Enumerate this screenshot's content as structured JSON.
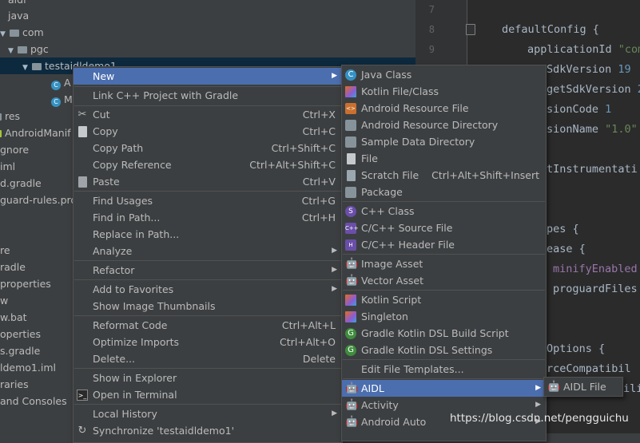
{
  "tree": {
    "items": [
      "aidl",
      "java",
      "com",
      "pgc",
      "testaidldemo1",
      "A",
      "M",
      "res",
      "AndroidManif",
      "gnore",
      "iml",
      "d.gradle",
      "guard-rules.pro",
      "re",
      "radle",
      "properties",
      "w",
      "w.bat",
      "operties",
      "s.gradle",
      "ldemo1.iml",
      "raries",
      "and Consoles"
    ],
    "class_icon_letter": "C"
  },
  "editor": {
    "line_numbers": [
      "7",
      "8",
      "9"
    ],
    "lines": [
      {
        "a": "defaultConfig {",
        "b": "",
        "c": ""
      },
      {
        "a": "applicationId ",
        "b": "\"com",
        "c": ""
      },
      {
        "a": "SdkVersion ",
        "b": "19",
        "c": ""
      },
      {
        "a": "getSdkVersion ",
        "b": "2",
        "c": ""
      },
      {
        "a": "sionCode ",
        "b": "1",
        "c": ""
      },
      {
        "a": "sionName ",
        "b": "\"1.0\"",
        "c": ""
      },
      {
        "a": "tInstrumentati",
        "b": "",
        "c": ""
      },
      {
        "a": "pes {",
        "b": "",
        "c": ""
      },
      {
        "a": "ease {",
        "b": "",
        "c": ""
      },
      {
        "a": "",
        "b": "minifyEnabled",
        "c": ""
      },
      {
        "a": "proguardFiles",
        "b": "",
        "c": ""
      },
      {
        "a": "Options {",
        "b": "",
        "c": ""
      },
      {
        "a": "rceCompatibil",
        "b": "",
        "c": ""
      },
      {
        "a": "ili",
        "b": "",
        "c": ""
      }
    ]
  },
  "context_menu": {
    "items": [
      {
        "label": "New",
        "shortcut": "",
        "submenu": true
      },
      {
        "label": "Link C++ Project with Gradle",
        "shortcut": ""
      },
      {
        "label": "Cut",
        "shortcut": "Ctrl+X"
      },
      {
        "label": "Copy",
        "shortcut": "Ctrl+C"
      },
      {
        "label": "Copy Path",
        "shortcut": "Ctrl+Shift+C"
      },
      {
        "label": "Copy Reference",
        "shortcut": "Ctrl+Alt+Shift+C"
      },
      {
        "label": "Paste",
        "shortcut": "Ctrl+V"
      },
      {
        "label": "Find Usages",
        "shortcut": "Ctrl+G"
      },
      {
        "label": "Find in Path...",
        "shortcut": "Ctrl+H"
      },
      {
        "label": "Replace in Path...",
        "shortcut": ""
      },
      {
        "label": "Analyze",
        "shortcut": "",
        "submenu": true
      },
      {
        "label": "Refactor",
        "shortcut": "",
        "submenu": true
      },
      {
        "label": "Add to Favorites",
        "shortcut": "",
        "submenu": true
      },
      {
        "label": "Show Image Thumbnails",
        "shortcut": ""
      },
      {
        "label": "Reformat Code",
        "shortcut": "Ctrl+Alt+L"
      },
      {
        "label": "Optimize Imports",
        "shortcut": "Ctrl+Alt+O"
      },
      {
        "label": "Delete...",
        "shortcut": "Delete"
      },
      {
        "label": "Show in Explorer",
        "shortcut": ""
      },
      {
        "label": "Open in Terminal",
        "shortcut": ""
      },
      {
        "label": "Local History",
        "shortcut": "",
        "submenu": true
      },
      {
        "label": "Synchronize 'testaidldemo1'",
        "shortcut": ""
      }
    ]
  },
  "new_menu": {
    "items": [
      {
        "label": "Java Class",
        "shortcut": ""
      },
      {
        "label": "Kotlin File/Class",
        "shortcut": ""
      },
      {
        "label": "Android Resource File",
        "shortcut": ""
      },
      {
        "label": "Android Resource Directory",
        "shortcut": ""
      },
      {
        "label": "Sample Data Directory",
        "shortcut": ""
      },
      {
        "label": "File",
        "shortcut": ""
      },
      {
        "label": "Scratch File",
        "shortcut": "Ctrl+Alt+Shift+Insert"
      },
      {
        "label": "Package",
        "shortcut": ""
      },
      {
        "label": "C++ Class",
        "shortcut": ""
      },
      {
        "label": "C/C++ Source File",
        "shortcut": ""
      },
      {
        "label": "C/C++ Header File",
        "shortcut": ""
      },
      {
        "label": "Image Asset",
        "shortcut": ""
      },
      {
        "label": "Vector Asset",
        "shortcut": ""
      },
      {
        "label": "Kotlin Script",
        "shortcut": ""
      },
      {
        "label": "Singleton",
        "shortcut": ""
      },
      {
        "label": "Gradle Kotlin DSL Build Script",
        "shortcut": ""
      },
      {
        "label": "Gradle Kotlin DSL Settings",
        "shortcut": ""
      },
      {
        "label": "Edit File Templates...",
        "shortcut": ""
      },
      {
        "label": "AIDL",
        "shortcut": "",
        "submenu": true
      },
      {
        "label": "Activity",
        "shortcut": "",
        "submenu": true
      },
      {
        "label": "Android Auto",
        "shortcut": "",
        "submenu": true
      }
    ],
    "icon_letters": {
      "java": "C",
      "cpp": "S",
      "cpp_source": "C++",
      "cpp_header": "H"
    }
  },
  "aidl_menu": {
    "items": [
      {
        "label": "AIDL File"
      }
    ]
  },
  "watermark": "https://blog.csdn.net/pengguichu",
  "colors": {
    "highlight": "#4b6eaf",
    "menu_bg": "#3c3f41",
    "editor_bg": "#2b2b2b",
    "tree_selection": "#0d293e"
  }
}
